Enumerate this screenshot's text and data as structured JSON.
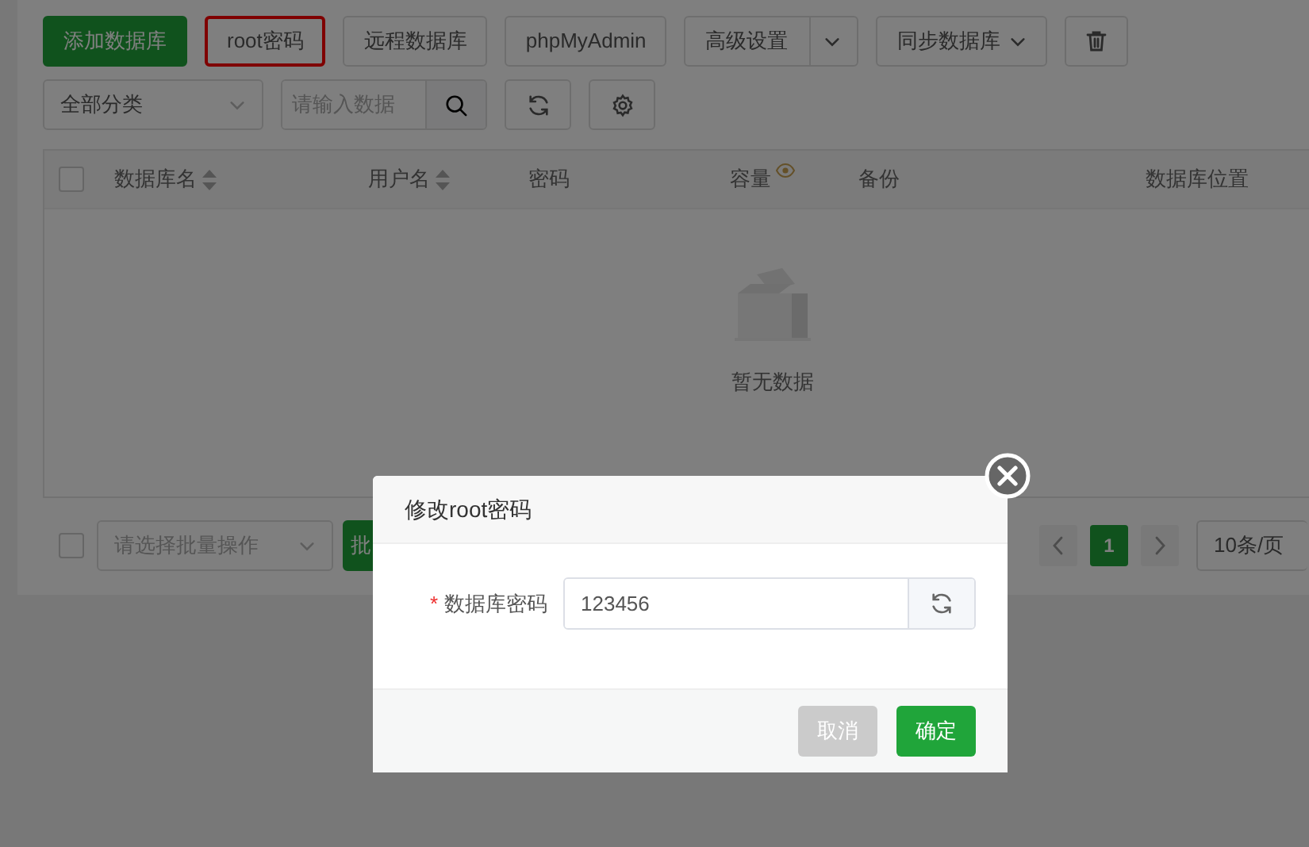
{
  "toolbar": {
    "buttons": [
      {
        "kind": "primary",
        "label": "添加数据库",
        "highlighted": false
      },
      {
        "kind": "default",
        "label": "root密码",
        "highlighted": true
      },
      {
        "kind": "default",
        "label": "远程数据库",
        "highlighted": false
      },
      {
        "kind": "default",
        "label": "phpMyAdmin",
        "highlighted": false
      },
      {
        "kind": "split",
        "label": "高级设置",
        "highlighted": false
      },
      {
        "kind": "dropdown",
        "label": "同步数据库",
        "highlighted": false
      },
      {
        "kind": "trash",
        "highlighted": false
      }
    ]
  },
  "filters": {
    "category": "全部分类",
    "search": {
      "placeholder": "请输入数据"
    },
    "tools": [
      {
        "kind": "refresh"
      },
      {
        "kind": "settings"
      }
    ]
  },
  "table": {
    "select_all": {
      "checked": false
    },
    "columns": [
      {
        "label": "数据库名",
        "kind": "sortable"
      },
      {
        "label": "用户名",
        "kind": "sortable"
      },
      {
        "label": "密码",
        "kind": "plain"
      },
      {
        "label": "容量",
        "kind": "eye"
      },
      {
        "label": "备份",
        "kind": "plain"
      },
      {
        "label": "数据库位置",
        "kind": "plain"
      }
    ],
    "empty_text": "暂无数据"
  },
  "footer": {
    "select_all": {
      "checked": false
    },
    "batch": {
      "placeholder": "请选择批量操作"
    },
    "batch_button": "批",
    "pages": [
      {
        "label": "1",
        "selected": true
      }
    ],
    "page_size": "10条/页"
  },
  "dialog": {
    "title": "修改root密码",
    "field": {
      "required_mark": "*",
      "label": "数据库密码",
      "value": "123456"
    },
    "cancel": {
      "label": "取消",
      "disabled": true
    },
    "confirm": {
      "label": "确定",
      "disabled": false
    }
  }
}
